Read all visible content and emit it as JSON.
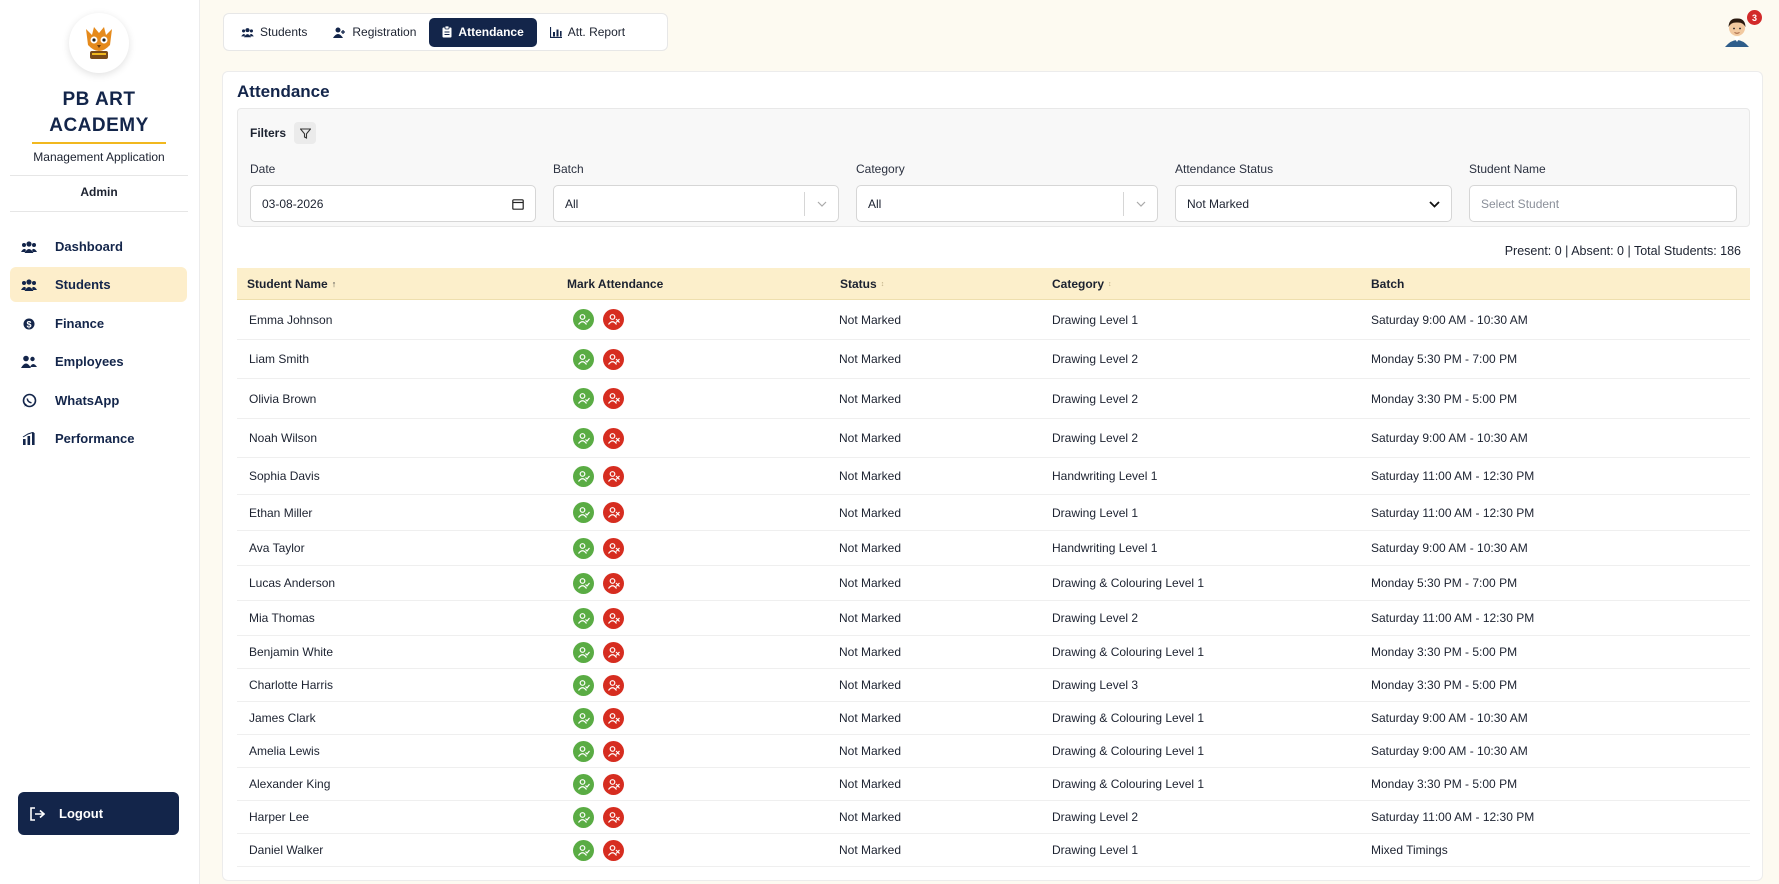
{
  "app": {
    "brand_line1": "PB ART",
    "brand_line2": "ACADEMY",
    "subtitle": "Management Application",
    "role": "Admin",
    "accent": "#f1b81f",
    "navy": "#13254a"
  },
  "sidebar": {
    "items": [
      {
        "label": "Dashboard",
        "icon": "users-icon",
        "active": false
      },
      {
        "label": "Students",
        "icon": "users-icon",
        "active": true
      },
      {
        "label": "Finance",
        "icon": "dollar-icon",
        "active": false
      },
      {
        "label": "Employees",
        "icon": "user-group-icon",
        "active": false
      },
      {
        "label": "WhatsApp",
        "icon": "whatsapp-icon",
        "active": false
      },
      {
        "label": "Performance",
        "icon": "bar-chart-icon",
        "active": false
      }
    ],
    "logout_label": "Logout"
  },
  "tabs": [
    {
      "label": "Students",
      "icon": "users-icon",
      "active": false
    },
    {
      "label": "Registration",
      "icon": "user-plus-icon",
      "active": false
    },
    {
      "label": "Attendance",
      "icon": "clipboard-icon",
      "active": true
    },
    {
      "label": "Att. Report",
      "icon": "chart-icon",
      "active": false
    }
  ],
  "header": {
    "notification_count": "3"
  },
  "page": {
    "title": "Attendance",
    "filters_label": "Filters",
    "filters": {
      "date_label": "Date",
      "date_value": "03-08-2026",
      "batch_label": "Batch",
      "batch_value": "All",
      "category_label": "Category",
      "category_value": "All",
      "status_label": "Attendance Status",
      "status_value": "Not Marked",
      "student_label": "Student Name",
      "student_placeholder": "Select Student"
    },
    "summary": "Present: 0 | Absent: 0 | Total Students: 186"
  },
  "table": {
    "columns": [
      "Student Name",
      "Mark Attendance",
      "Status",
      "Category",
      "Batch"
    ],
    "rows": [
      {
        "name": "Emma Johnson",
        "status": "Not Marked",
        "category": "Drawing Level 1",
        "batch": "Saturday 9:00 AM - 10:30 AM"
      },
      {
        "name": "Liam Smith",
        "status": "Not Marked",
        "category": "Drawing Level 2",
        "batch": "Monday 5:30 PM - 7:00 PM"
      },
      {
        "name": "Olivia Brown",
        "status": "Not Marked",
        "category": "Drawing Level 2",
        "batch": "Monday 3:30 PM - 5:00 PM"
      },
      {
        "name": "Noah Wilson",
        "status": "Not Marked",
        "category": "Drawing Level 2",
        "batch": "Saturday 9:00 AM - 10:30 AM"
      },
      {
        "name": "Sophia Davis",
        "status": "Not Marked",
        "category": "Handwriting Level 1",
        "batch": "Saturday 11:00 AM - 12:30 PM"
      },
      {
        "name": "Ethan Miller",
        "status": "Not Marked",
        "category": "Drawing Level 1",
        "batch": "Saturday 11:00 AM - 12:30 PM"
      },
      {
        "name": "Ava Taylor",
        "status": "Not Marked",
        "category": "Handwriting Level 1",
        "batch": "Saturday 9:00 AM - 10:30 AM"
      },
      {
        "name": "Lucas Anderson",
        "status": "Not Marked",
        "category": "Drawing & Colouring Level 1",
        "batch": "Monday 5:30 PM - 7:00 PM"
      },
      {
        "name": "Mia Thomas",
        "status": "Not Marked",
        "category": "Drawing Level 2",
        "batch": "Saturday 11:00 AM - 12:30 PM"
      },
      {
        "name": "Benjamin White",
        "status": "Not Marked",
        "category": "Drawing & Colouring Level 1",
        "batch": "Monday 3:30 PM - 5:00 PM"
      },
      {
        "name": "Charlotte Harris",
        "status": "Not Marked",
        "category": "Drawing Level 3",
        "batch": "Monday 3:30 PM - 5:00 PM"
      },
      {
        "name": "James Clark",
        "status": "Not Marked",
        "category": "Drawing & Colouring Level 1",
        "batch": "Saturday 9:00 AM - 10:30 AM"
      },
      {
        "name": "Amelia Lewis",
        "status": "Not Marked",
        "category": "Drawing & Colouring Level 1",
        "batch": "Saturday 9:00 AM - 10:30 AM"
      },
      {
        "name": "Alexander King",
        "status": "Not Marked",
        "category": "Drawing & Colouring Level 1",
        "batch": "Monday 3:30 PM - 5:00 PM"
      },
      {
        "name": "Harper Lee",
        "status": "Not Marked",
        "category": "Drawing Level 2",
        "batch": "Saturday 11:00 AM - 12:30 PM"
      },
      {
        "name": "Daniel Walker",
        "status": "Not Marked",
        "category": "Drawing Level 1",
        "batch": "Mixed Timings"
      }
    ]
  }
}
